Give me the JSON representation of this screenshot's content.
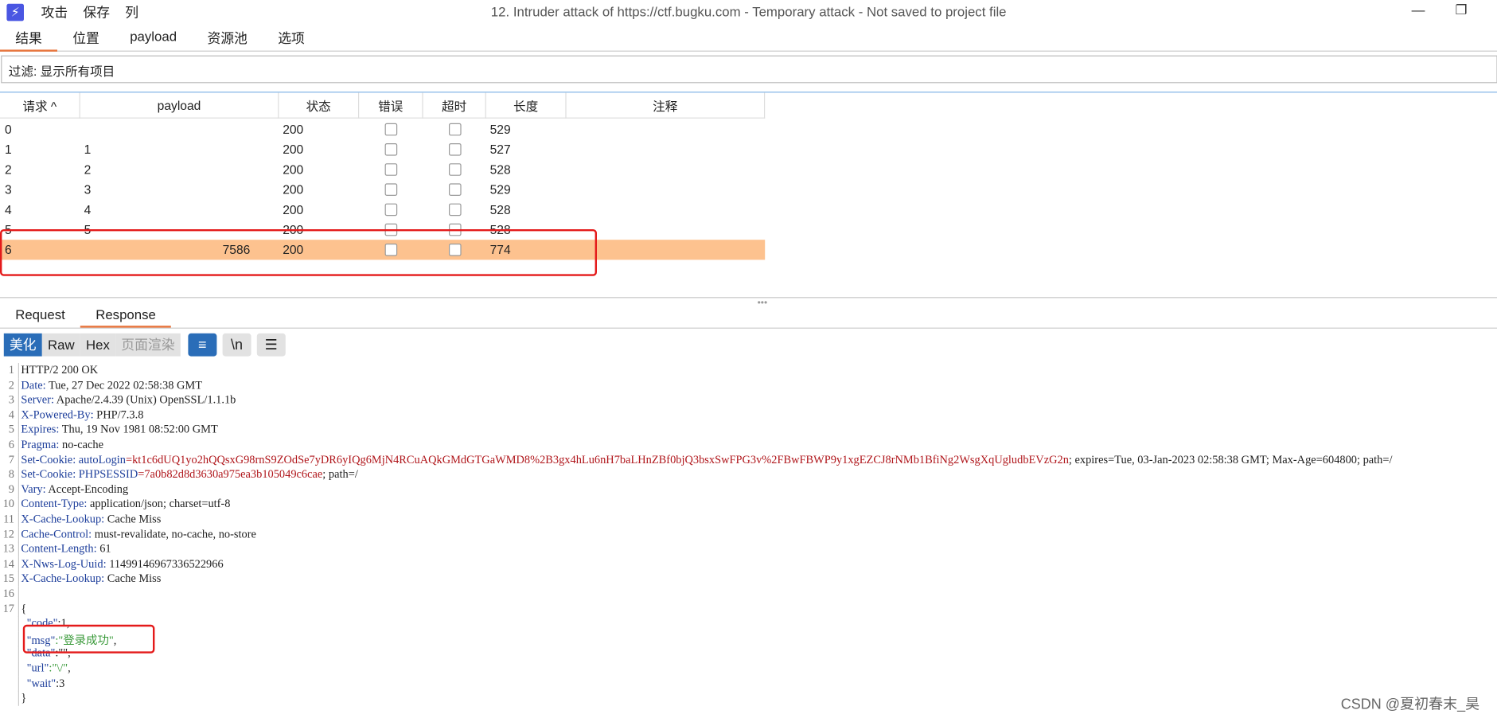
{
  "app": {
    "logo": "⚡",
    "menu": [
      "攻击",
      "保存",
      "列"
    ],
    "title": "12. Intruder attack of https://ctf.bugku.com - Temporary attack - Not saved to project file",
    "minimize": "—",
    "restore": "❐"
  },
  "tabs": [
    "结果",
    "位置",
    "payload",
    "资源池",
    "选项"
  ],
  "filter": {
    "text": "过滤: 显示所有项目"
  },
  "table": {
    "headers": [
      "请求 ^",
      "payload",
      "状态",
      "错误",
      "超时",
      "长度",
      "注释"
    ],
    "rows": [
      {
        "request": "0",
        "payload": "",
        "status": "200",
        "length": "529"
      },
      {
        "request": "1",
        "payload": "1",
        "status": "200",
        "length": "527"
      },
      {
        "request": "2",
        "payload": "2",
        "status": "200",
        "length": "528"
      },
      {
        "request": "3",
        "payload": "3",
        "status": "200",
        "length": "529"
      },
      {
        "request": "4",
        "payload": "4",
        "status": "200",
        "length": "528"
      },
      {
        "request": "5",
        "payload": "5",
        "status": "200",
        "length": "528"
      },
      {
        "request": "6",
        "payload": "7586",
        "status": "200",
        "length": "774"
      }
    ]
  },
  "splitter": "•••",
  "response_tabs": [
    "Request",
    "Response"
  ],
  "view_buttons": [
    "美化",
    "Raw",
    "Hex",
    "页面渲染"
  ],
  "icon_buttons": [
    "≡",
    "\\n",
    "☰"
  ],
  "code_lines": [
    {
      "n": "1",
      "k": "",
      "v": "HTTP/2 200 OK"
    },
    {
      "n": "2",
      "k": "Date:",
      "v": " Tue, 27 Dec 2022 02:58:38 GMT"
    },
    {
      "n": "3",
      "k": "Server:",
      "v": " Apache/2.4.39 (Unix) OpenSSL/1.1.1b"
    },
    {
      "n": "4",
      "k": "X-Powered-By:",
      "v": " PHP/7.3.8"
    },
    {
      "n": "5",
      "k": "Expires:",
      "v": " Thu, 19 Nov 1981 08:52:00 GMT"
    },
    {
      "n": "6",
      "k": "Pragma:",
      "v": " no-cache"
    },
    {
      "n": "7",
      "k": "Set-Cookie:",
      "ck": " autoLogin",
      "cv": "=kt1c6dUQ1yo2hQQsxG98rnS9ZOdSe7yDR6yIQg6MjN4RCuAQkGMdGTGaWMD8%2B3gx4hLu6nH7baLHnZBf0bjQ3bsxSwFPG3v%2FBwFBWP9y1xgEZCJ8rNMb1BfiNg2WsgXqUgludbEVzG2n",
      "v": "; expires=Tue, 03-Jan-2023 02:58:38 GMT; Max-Age=604800; path=/"
    },
    {
      "n": "8",
      "k": "Set-Cookie:",
      "ck": " PHPSESSID",
      "cv": "=7a0b82d8d3630a975ea3b105049c6cae",
      "v": "; path=/"
    },
    {
      "n": "9",
      "k": "Vary:",
      "v": " Accept-Encoding"
    },
    {
      "n": "10",
      "k": "Content-Type:",
      "v": " application/json; charset=utf-8"
    },
    {
      "n": "11",
      "k": "X-Cache-Lookup:",
      "v": " Cache Miss"
    },
    {
      "n": "12",
      "k": "Cache-Control:",
      "v": " must-revalidate, no-cache, no-store"
    },
    {
      "n": "13",
      "k": "Content-Length:",
      "v": " 61"
    },
    {
      "n": "14",
      "k": "X-Nws-Log-Uuid:",
      "v": " 11499146967336522966"
    },
    {
      "n": "15",
      "k": "X-Cache-Lookup:",
      "v": " Cache Miss"
    },
    {
      "n": "16",
      "k": "",
      "v": ""
    },
    {
      "n": "17",
      "k": "",
      "v": "{"
    },
    {
      "n": "",
      "k": "  \"code\"",
      "v": ":1,"
    },
    {
      "n": "",
      "k": "  \"msg\"",
      "s": ":\"登录成功\"",
      "v": ","
    },
    {
      "n": "",
      "k": "  \"data\"",
      "v": ":\"\","
    },
    {
      "n": "",
      "k": "  \"url\"",
      "s": ":\"\\/\"",
      "v": ","
    },
    {
      "n": "",
      "k": "  \"wait\"",
      "v": ":3"
    },
    {
      "n": "",
      "k": "",
      "v": "}"
    }
  ],
  "watermark": "CSDN @夏初春末_昊"
}
